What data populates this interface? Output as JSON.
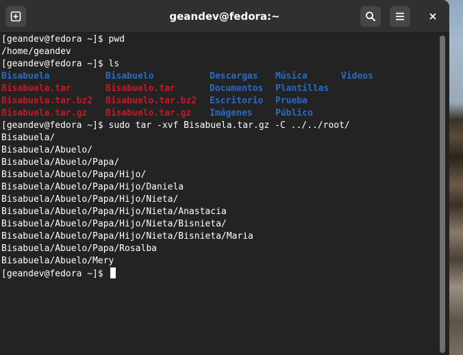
{
  "window": {
    "title": "geandev@fedora:~"
  },
  "icons": {
    "new_tab": "new-tab-icon",
    "search": "search-icon",
    "menu": "hamburger-menu-icon",
    "close": "close-icon"
  },
  "colors": {
    "directory": "#2a6bc3",
    "archive": "#c01c28",
    "background": "#232323",
    "text": "#ffffff"
  },
  "terminal": {
    "prompt": "[geandev@fedora ~]$ ",
    "cmd1": "pwd",
    "out1": "/home/geandev",
    "cmd2": "ls",
    "ls_rows": [
      [
        {
          "name": "Bisabuela",
          "kind": "dir"
        },
        {
          "name": "Bisabuelo",
          "kind": "dir"
        },
        {
          "name": "Descargas",
          "kind": "dir"
        },
        {
          "name": "Música",
          "kind": "dir"
        },
        {
          "name": "Videos",
          "kind": "dir"
        }
      ],
      [
        {
          "name": "Bisabuela.tar",
          "kind": "arc"
        },
        {
          "name": "Bisabuelo.tar",
          "kind": "arc"
        },
        {
          "name": "Documentos",
          "kind": "dir"
        },
        {
          "name": "Plantillas",
          "kind": "dir"
        }
      ],
      [
        {
          "name": "Bisabuela.tar.bz2",
          "kind": "arc"
        },
        {
          "name": "Bisabuelo.tar.bz2",
          "kind": "arc"
        },
        {
          "name": "Escritorio",
          "kind": "dir"
        },
        {
          "name": "Prueba",
          "kind": "dir"
        }
      ],
      [
        {
          "name": "Bisabuela.tar.gz",
          "kind": "arc"
        },
        {
          "name": "Bisabuelo.tar.gz",
          "kind": "arc"
        },
        {
          "name": "Imágenes",
          "kind": "dir"
        },
        {
          "name": "Público",
          "kind": "dir"
        }
      ]
    ],
    "cmd3": "sudo tar -xvf Bisabuela.tar.gz -C ../../root/",
    "tar_output": [
      "Bisabuela/",
      "Bisabuela/Abuelo/",
      "Bisabuela/Abuelo/Papa/",
      "Bisabuela/Abuelo/Papa/Hijo/",
      "Bisabuela/Abuelo/Papa/Hijo/Daniela",
      "Bisabuela/Abuelo/Papa/Hijo/Nieta/",
      "Bisabuela/Abuelo/Papa/Hijo/Nieta/Anastacia",
      "Bisabuela/Abuelo/Papa/Hijo/Nieta/Bisnieta/",
      "Bisabuela/Abuelo/Papa/Hijo/Nieta/Bisnieta/Maria",
      "Bisabuela/Abuelo/Papa/Rosalba",
      "Bisabuela/Abuelo/Mery"
    ]
  }
}
